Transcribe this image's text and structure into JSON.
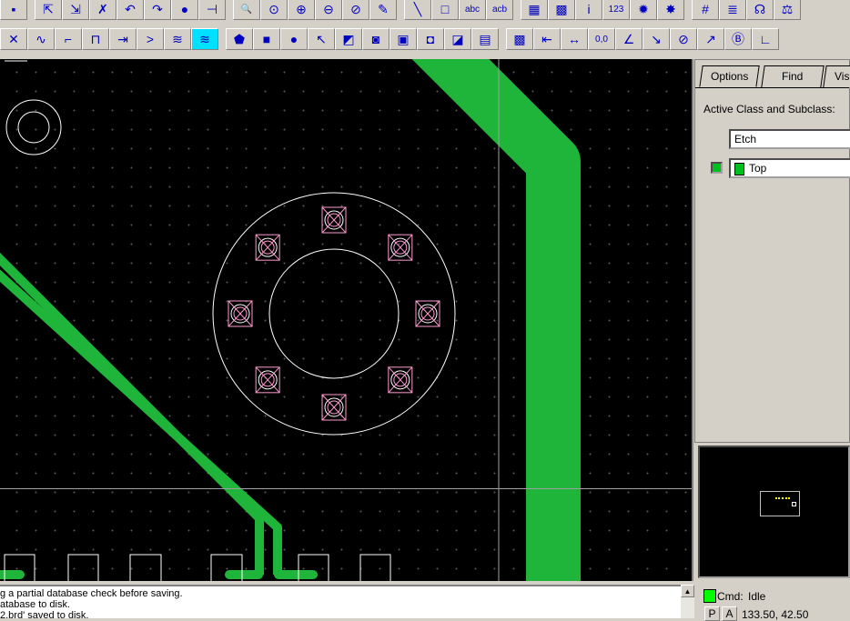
{
  "toolbar_row1": [
    {
      "name": "save-icon",
      "glyph": "▪"
    },
    {
      "name": "move-icon",
      "glyph": "⇱"
    },
    {
      "name": "copy-icon",
      "glyph": "⇲"
    },
    {
      "name": "delete-icon",
      "glyph": "✗"
    },
    {
      "name": "undo-icon",
      "glyph": "↶"
    },
    {
      "name": "redo-icon",
      "glyph": "↷"
    },
    {
      "name": "fix-icon",
      "glyph": "●"
    },
    {
      "name": "pin-icon",
      "glyph": "⊣"
    },
    {
      "name": "zoom-points-icon",
      "glyph": "🔍"
    },
    {
      "name": "zoom-fit-icon",
      "glyph": "⊙"
    },
    {
      "name": "zoom-in-icon",
      "glyph": "⊕"
    },
    {
      "name": "zoom-out-icon",
      "glyph": "⊖"
    },
    {
      "name": "zoom-previous-icon",
      "glyph": "⊘"
    },
    {
      "name": "redraw-icon",
      "glyph": "✎"
    },
    {
      "name": "add-line-icon",
      "glyph": "╲"
    },
    {
      "name": "add-rect-icon",
      "glyph": "□"
    },
    {
      "name": "add-text-icon",
      "glyph": "abc"
    },
    {
      "name": "edit-text-icon",
      "glyph": "acb"
    },
    {
      "name": "color-icon",
      "glyph": "▦"
    },
    {
      "name": "layer-visibility-icon",
      "glyph": "▩"
    },
    {
      "name": "info-icon",
      "glyph": "i"
    },
    {
      "name": "measure-icon",
      "glyph": "123"
    },
    {
      "name": "highlight-icon",
      "glyph": "✹"
    },
    {
      "name": "dehighlight-icon",
      "glyph": "✸"
    },
    {
      "name": "grid-icon",
      "glyph": "#"
    },
    {
      "name": "layers-icon",
      "glyph": "≣"
    },
    {
      "name": "ratsnest-icon",
      "glyph": "☊"
    },
    {
      "name": "balance-icon",
      "glyph": "⚖"
    }
  ],
  "toolbar_row2": [
    {
      "name": "connect-icon",
      "glyph": "✕"
    },
    {
      "name": "slide-icon",
      "glyph": "∿"
    },
    {
      "name": "vertex-icon",
      "glyph": "⌐"
    },
    {
      "name": "delay-tune-icon",
      "glyph": "⊓"
    },
    {
      "name": "spread-icon",
      "glyph": "⇥"
    },
    {
      "name": "fanout-icon",
      "glyph": ">"
    },
    {
      "name": "phase-tune-icon",
      "glyph": "≋"
    },
    {
      "name": "timing-vision-icon",
      "glyph": "≋",
      "active": true
    },
    {
      "name": "shape-poly-icon",
      "glyph": "⬟"
    },
    {
      "name": "shape-rect-icon",
      "glyph": "■"
    },
    {
      "name": "shape-circle-icon",
      "glyph": "●"
    },
    {
      "name": "select-icon",
      "glyph": "↖"
    },
    {
      "name": "void-poly-icon",
      "glyph": "◩"
    },
    {
      "name": "void-circle-icon",
      "glyph": "◙"
    },
    {
      "name": "void-rect-icon",
      "glyph": "▣"
    },
    {
      "name": "void-element-icon",
      "glyph": "◘"
    },
    {
      "name": "shape-edit-icon",
      "glyph": "◪"
    },
    {
      "name": "shape-merge-icon",
      "glyph": "▤"
    },
    {
      "name": "dimension-icon",
      "glyph": "▩"
    },
    {
      "name": "dim-linear-icon",
      "glyph": "⇤"
    },
    {
      "name": "dim-aligned-icon",
      "glyph": "↔"
    },
    {
      "name": "dim-datum-icon",
      "glyph": "0,0"
    },
    {
      "name": "dim-angular-icon",
      "glyph": "∠"
    },
    {
      "name": "dim-leader-icon",
      "glyph": "↘"
    },
    {
      "name": "dim-diameter-icon",
      "glyph": "⊘"
    },
    {
      "name": "dim-radius-icon",
      "glyph": "↗"
    },
    {
      "name": "balloon-icon",
      "glyph": "Ⓑ"
    },
    {
      "name": "chamfer-icon",
      "glyph": "∟"
    }
  ],
  "panel": {
    "tabs": [
      "Options",
      "Find",
      "Visi"
    ],
    "active_class_label": "Active Class and Subclass:",
    "class_value": "Etch",
    "subclass_value": "Top",
    "subclass_color": "#00c020"
  },
  "console": {
    "lines": [
      "g a partial database check before saving.",
      "atabase to disk.",
      "2.brd' saved to disk."
    ]
  },
  "status": {
    "cmd_label": "Cmd:",
    "cmd_value": "Idle",
    "p_button": "P",
    "a_button": "A",
    "coords": "133.50, 42.50",
    "idle_color": "#00ff00"
  },
  "colors": {
    "etch": "#1fb43a",
    "pad": "#ff9ad0",
    "outline": "#ffffff"
  }
}
